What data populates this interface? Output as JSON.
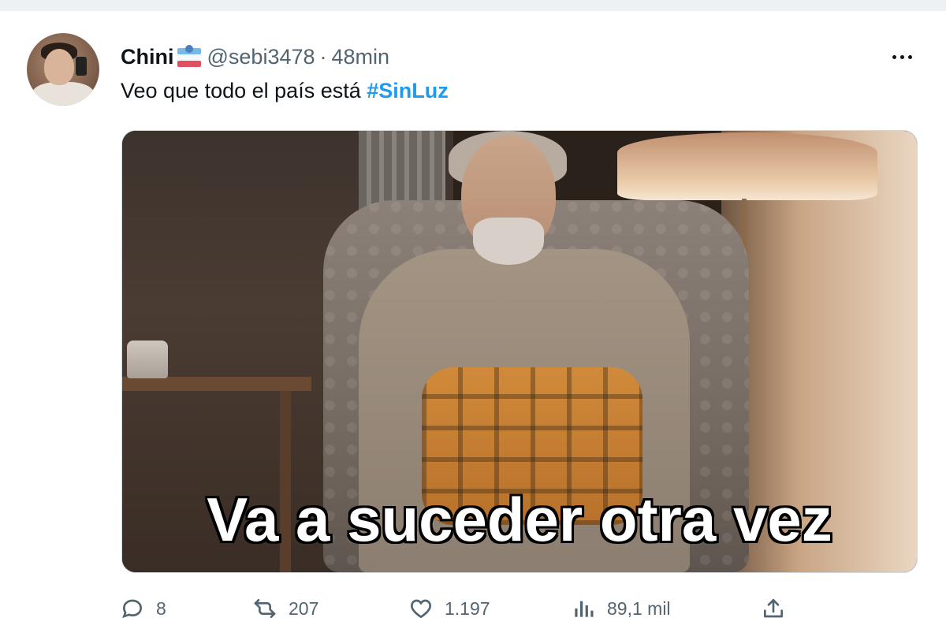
{
  "author": {
    "name": "Chini",
    "handle": "@sebi3478",
    "separator": "·",
    "time": "48min"
  },
  "tweet": {
    "text_prefix": "Veo que todo el país está ",
    "hashtag": "#SinLuz"
  },
  "media": {
    "caption": "Va a suceder otra vez"
  },
  "actions": {
    "replies": "8",
    "retweets": "207",
    "likes": "1.197",
    "views": "89,1 mil"
  },
  "icons": {
    "reply": "reply-icon",
    "retweet": "retweet-icon",
    "like": "heart-icon",
    "views": "views-icon",
    "share": "share-icon",
    "more": "more-icon"
  },
  "colors": {
    "accent": "#1d9bf0",
    "secondary_text": "#536471",
    "primary_text": "#0f1419"
  }
}
